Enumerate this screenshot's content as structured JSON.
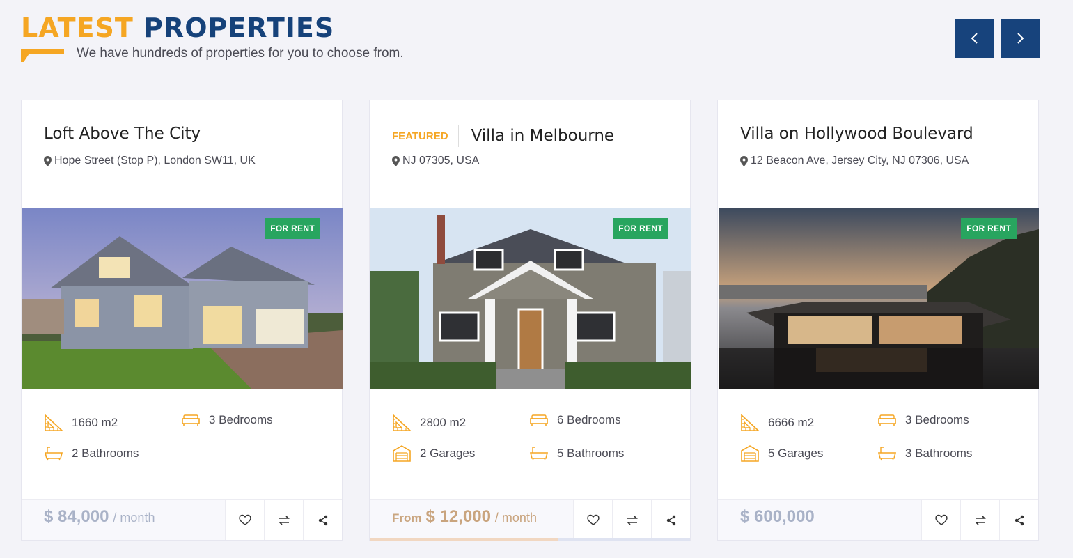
{
  "header": {
    "title_part1": "LATEST",
    "title_part2": "PROPERTIES",
    "subtitle": "We have hundreds of properties for you to choose from."
  },
  "nav": {
    "prev_icon": "chevron-left-icon",
    "next_icon": "chevron-right-icon"
  },
  "colors": {
    "accent": "#f5a623",
    "brand": "#16427a",
    "badge": "#28a55f"
  },
  "cards": [
    {
      "featured": "",
      "title": "Loft Above The City",
      "address": "Hope Street (Stop P), London SW11, UK",
      "badge": "FOR RENT",
      "features": [
        {
          "icon": "area-icon",
          "label": "1660 m2"
        },
        {
          "icon": "bed-icon",
          "label": "3 Bedrooms"
        },
        {
          "icon": "bath-icon",
          "label": "2 Bathrooms"
        }
      ],
      "price_prefix": "",
      "price": "$ 84,000",
      "price_suffix": "/ month",
      "progress": 0
    },
    {
      "featured": "FEATURED",
      "title": "Villa in Melbourne",
      "address": "NJ 07305, USA",
      "badge": "FOR RENT",
      "features": [
        {
          "icon": "area-icon",
          "label": "2800 m2"
        },
        {
          "icon": "bed-icon",
          "label": "6 Bedrooms"
        },
        {
          "icon": "garage-icon",
          "label": "2 Garages"
        },
        {
          "icon": "bath-icon",
          "label": "5 Bathrooms"
        }
      ],
      "price_prefix": "From",
      "price": "$ 12,000",
      "price_suffix": "/ month",
      "progress": 0.59
    },
    {
      "featured": "",
      "title": "Villa on Hollywood Boulevard",
      "address": "12 Beacon Ave, Jersey City, NJ 07306, USA",
      "badge": "FOR RENT",
      "features": [
        {
          "icon": "area-icon",
          "label": "6666 m2"
        },
        {
          "icon": "bed-icon",
          "label": "3 Bedrooms"
        },
        {
          "icon": "garage-icon",
          "label": "5 Garages"
        },
        {
          "icon": "bath-icon",
          "label": "3 Bathrooms"
        }
      ],
      "price_prefix": "",
      "price": "$ 600,000",
      "price_suffix": "",
      "progress": 0
    }
  ]
}
